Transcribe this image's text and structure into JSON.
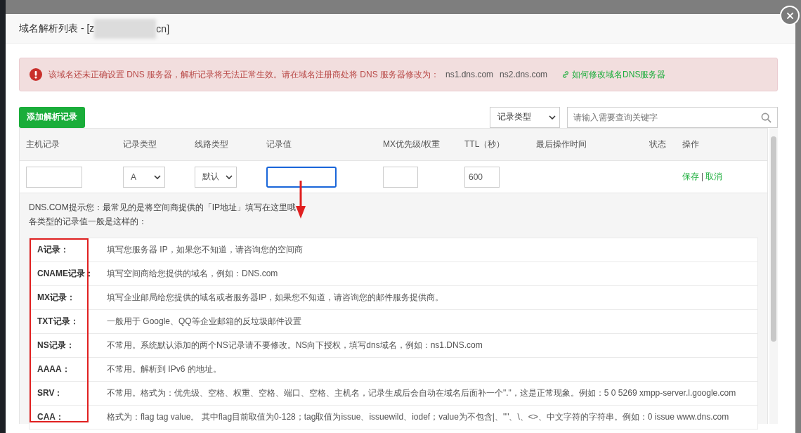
{
  "dialog": {
    "title_prefix": "域名解析列表 - [z",
    "title_suffix": "cn]"
  },
  "alert": {
    "message": "该域名还未正确设置 DNS 服务器，解析记录将无法正常生效。请在域名注册商处将 DNS 服务器修改为：",
    "nameservers": [
      "ns1.dns.com",
      "ns2.dns.com"
    ],
    "help_link": "如何修改域名DNS服务器"
  },
  "toolbar": {
    "add_button": "添加解析记录",
    "type_filter": "记录类型",
    "search": {
      "placeholder": "请输入需要查询关键字"
    }
  },
  "table": {
    "columns": [
      "主机记录",
      "记录类型",
      "线路类型",
      "记录值",
      "MX优先级/权重",
      "TTL（秒）",
      "最后操作时间",
      "状态",
      "操作"
    ],
    "new_row": {
      "type": "A",
      "line": "默认",
      "ttl": "600",
      "save": "保存",
      "separator": "|",
      "cancel": "取消"
    }
  },
  "tip": {
    "intro": "DNS.COM提示您：最常见的是将空间商提供的「IP地址」填写在这里哦",
    "subtitle": "各类型的记录值一般是这样的：",
    "records": [
      {
        "type": "A记录：",
        "desc": "填写您服务器 IP，如果您不知道，请咨询您的空间商"
      },
      {
        "type": "CNAME记录：",
        "desc": "填写空间商给您提供的域名，例如：DNS.com"
      },
      {
        "type": "MX记录：",
        "desc": "填写企业邮局给您提供的域名或者服务器IP，如果您不知道，请咨询您的邮件服务提供商。"
      },
      {
        "type": "TXT记录：",
        "desc": "一般用于 Google、QQ等企业邮箱的反垃圾邮件设置"
      },
      {
        "type": "NS记录：",
        "desc": "不常用。系统默认添加的两个NS记录请不要修改。NS向下授权，填写dns域名，例如：ns1.DNS.com"
      },
      {
        "type": "AAAA：",
        "desc": "不常用。解析到 IPv6 的地址。"
      },
      {
        "type": "SRV：",
        "desc": "不常用。格式为：优先级、空格、权重、空格、端口、空格、主机名，记录生成后会自动在域名后面补一个\".\"，这是正常现象。例如：5 0 5269 xmpp-server.l.google.com"
      },
      {
        "type": "CAA：",
        "desc": "格式为：flag tag value。 其中flag目前取值为0-128；tag取值为issue、issuewild、iodef；value为不包含|、\"\"、\\、<>、中文字符的字符串。例如：0 issue www.dns.com"
      }
    ]
  }
}
